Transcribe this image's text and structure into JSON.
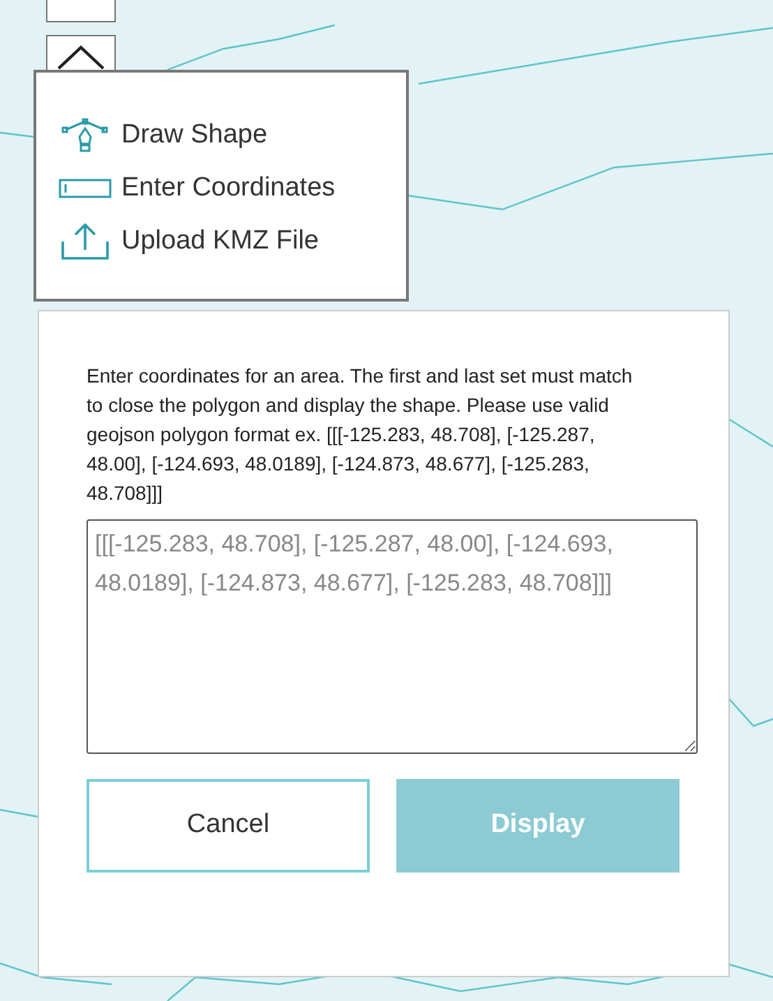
{
  "menu": {
    "items": [
      {
        "kind": "draw",
        "label": "Draw Shape"
      },
      {
        "kind": "coordinates",
        "label": "Enter Coordinates"
      },
      {
        "kind": "upload",
        "label": "Upload KMZ File"
      }
    ]
  },
  "coordinates_panel": {
    "instructions": "Enter coordinates for an area. The first and last set must match to close the polygon and display the shape. Please use valid geojson polygon format ex. [[[-125.283, 48.708], [-125.287, 48.00], [-124.693, 48.0189], [-124.873, 48.677], [-125.283, 48.708]]]",
    "placeholder": "[[[-125.283, 48.708], [-125.287, 48.00], [-124.693, 48.0189], [-124.873, 48.677], [-125.283, 48.708]]]",
    "buttons": [
      {
        "label": "Cancel",
        "disabled": false
      },
      {
        "label": "Display",
        "disabled": true
      }
    ]
  }
}
